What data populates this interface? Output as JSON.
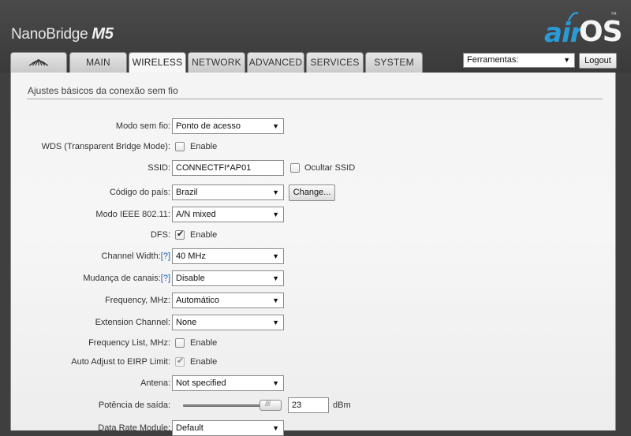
{
  "header": {
    "product_name": "NanoBridge",
    "product_model": "M5",
    "logo_air": "air",
    "logo_os": "OS",
    "logo_tm": "™"
  },
  "tabs": [
    {
      "label": "",
      "icon": "ubiquiti-logo-icon"
    },
    {
      "label": "MAIN"
    },
    {
      "label": "WIRELESS",
      "active": true
    },
    {
      "label": "NETWORK"
    },
    {
      "label": "ADVANCED"
    },
    {
      "label": "SERVICES"
    },
    {
      "label": "SYSTEM"
    }
  ],
  "toolbar": {
    "tools_selected": "Ferramentas:",
    "logout_label": "Logout"
  },
  "section": {
    "title": "Ajustes básicos da conexão sem fio"
  },
  "form": {
    "wireless_mode": {
      "label": "Modo sem fio:",
      "value": "Ponto de acesso"
    },
    "wds": {
      "label": "WDS (Transparent Bridge Mode):",
      "checkbox_label": "Enable",
      "checked": false
    },
    "ssid": {
      "label": "SSID:",
      "value": "CONNECTFI*AP01",
      "hide_label": "Ocultar SSID",
      "hide_checked": false
    },
    "country": {
      "label": "Código do país:",
      "value": "Brazil",
      "change_label": "Change..."
    },
    "ieee_mode": {
      "label": "Modo IEEE 802.11:",
      "value": "A/N mixed"
    },
    "dfs": {
      "label": "DFS:",
      "checkbox_label": "Enable",
      "checked": true
    },
    "channel_width": {
      "label": "Channel Width:",
      "help": "[?]",
      "value": "40 MHz"
    },
    "channel_shifting": {
      "label": "Mudança de canais:",
      "help": "[?]",
      "value": "Disable"
    },
    "frequency": {
      "label": "Frequency, MHz:",
      "value": "Automático"
    },
    "extension_channel": {
      "label": "Extension Channel:",
      "value": "None"
    },
    "frequency_list": {
      "label": "Frequency List, MHz:",
      "checkbox_label": "Enable",
      "checked": false
    },
    "auto_eirp": {
      "label": "Auto Adjust to EIRP Limit:",
      "checkbox_label": "Enable",
      "checked": true
    },
    "antenna": {
      "label": "Antena:",
      "value": "Not specified"
    },
    "output_power": {
      "label": "Potência de saída:",
      "value": "23",
      "unit": "dBm",
      "slider_fraction": 0.92
    },
    "data_rate_module": {
      "label": "Data Rate Module:",
      "value": "Default"
    }
  },
  "colors": {
    "header_bg": "#3f3f3f",
    "logo_air": "#2a9ad6",
    "help_link": "#1a5db0"
  }
}
